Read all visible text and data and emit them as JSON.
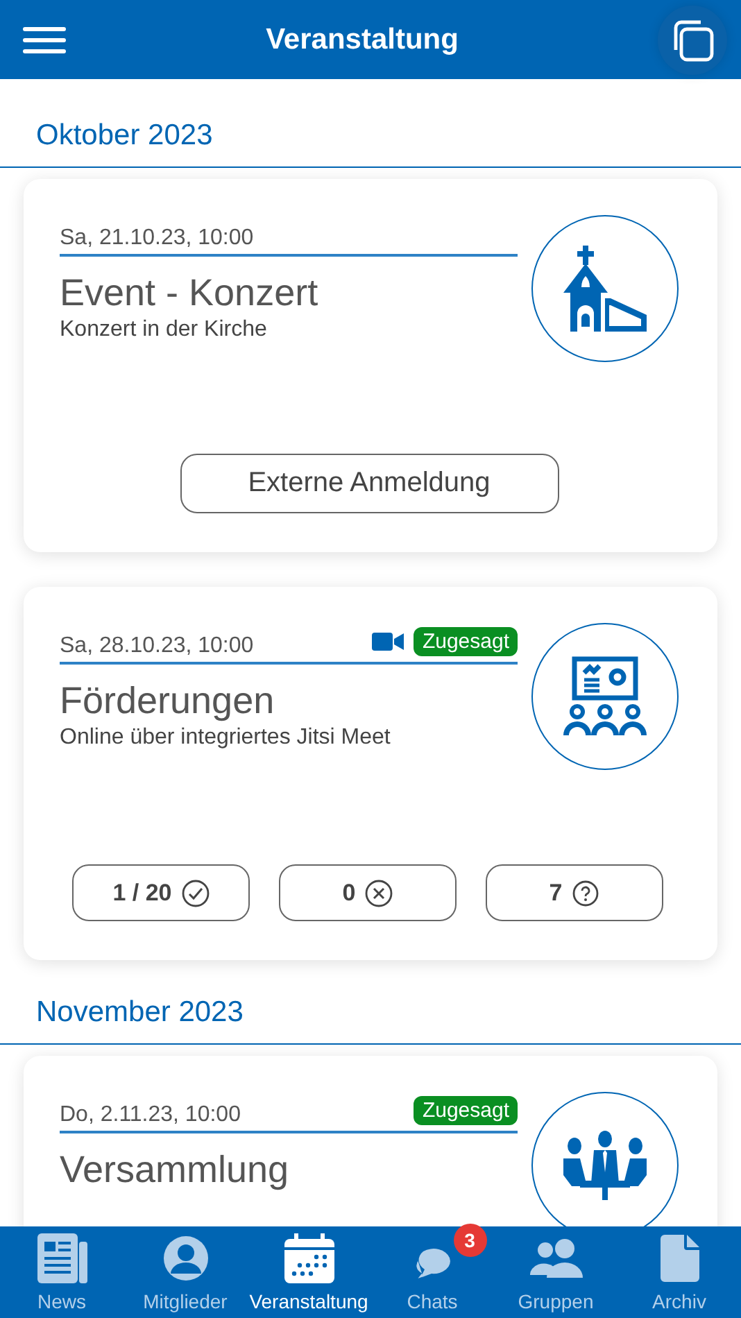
{
  "header": {
    "title": "Veranstaltung"
  },
  "sections": [
    {
      "month": "Oktober 2023",
      "events": [
        {
          "date": "Sa, 21.10.23, 10:00",
          "title": "Event - Konzert",
          "subtitle": "Konzert in der Kirche",
          "kind": "church",
          "video": false,
          "action": "Externe Anmeldung"
        },
        {
          "date": "Sa, 28.10.23, 10:00",
          "title": "Förderungen",
          "subtitle": "Online über integriertes Jitsi Meet",
          "kind": "presentation",
          "video": true,
          "status": "Zugesagt",
          "counts": [
            {
              "kind": "accepted",
              "text": "1 / 20"
            },
            {
              "kind": "declined",
              "text": "0"
            },
            {
              "kind": "unanswered",
              "text": "7"
            }
          ]
        }
      ]
    },
    {
      "month": "November 2023",
      "events": [
        {
          "date": "Do, 2.11.23, 10:00",
          "title": "Versammlung",
          "kind": "meeting",
          "video": false,
          "status": "Zugesagt"
        }
      ]
    }
  ],
  "nav": [
    {
      "kind": "news",
      "label": "News",
      "selected": false
    },
    {
      "kind": "person",
      "label": "Mitglieder",
      "selected": false
    },
    {
      "kind": "calendar",
      "label": "Veranstaltung",
      "selected": true
    },
    {
      "kind": "chat",
      "label": "Chats",
      "selected": false,
      "badge": "3"
    },
    {
      "kind": "group",
      "label": "Gruppen",
      "selected": false
    },
    {
      "kind": "file",
      "label": "Archiv",
      "selected": false
    }
  ]
}
